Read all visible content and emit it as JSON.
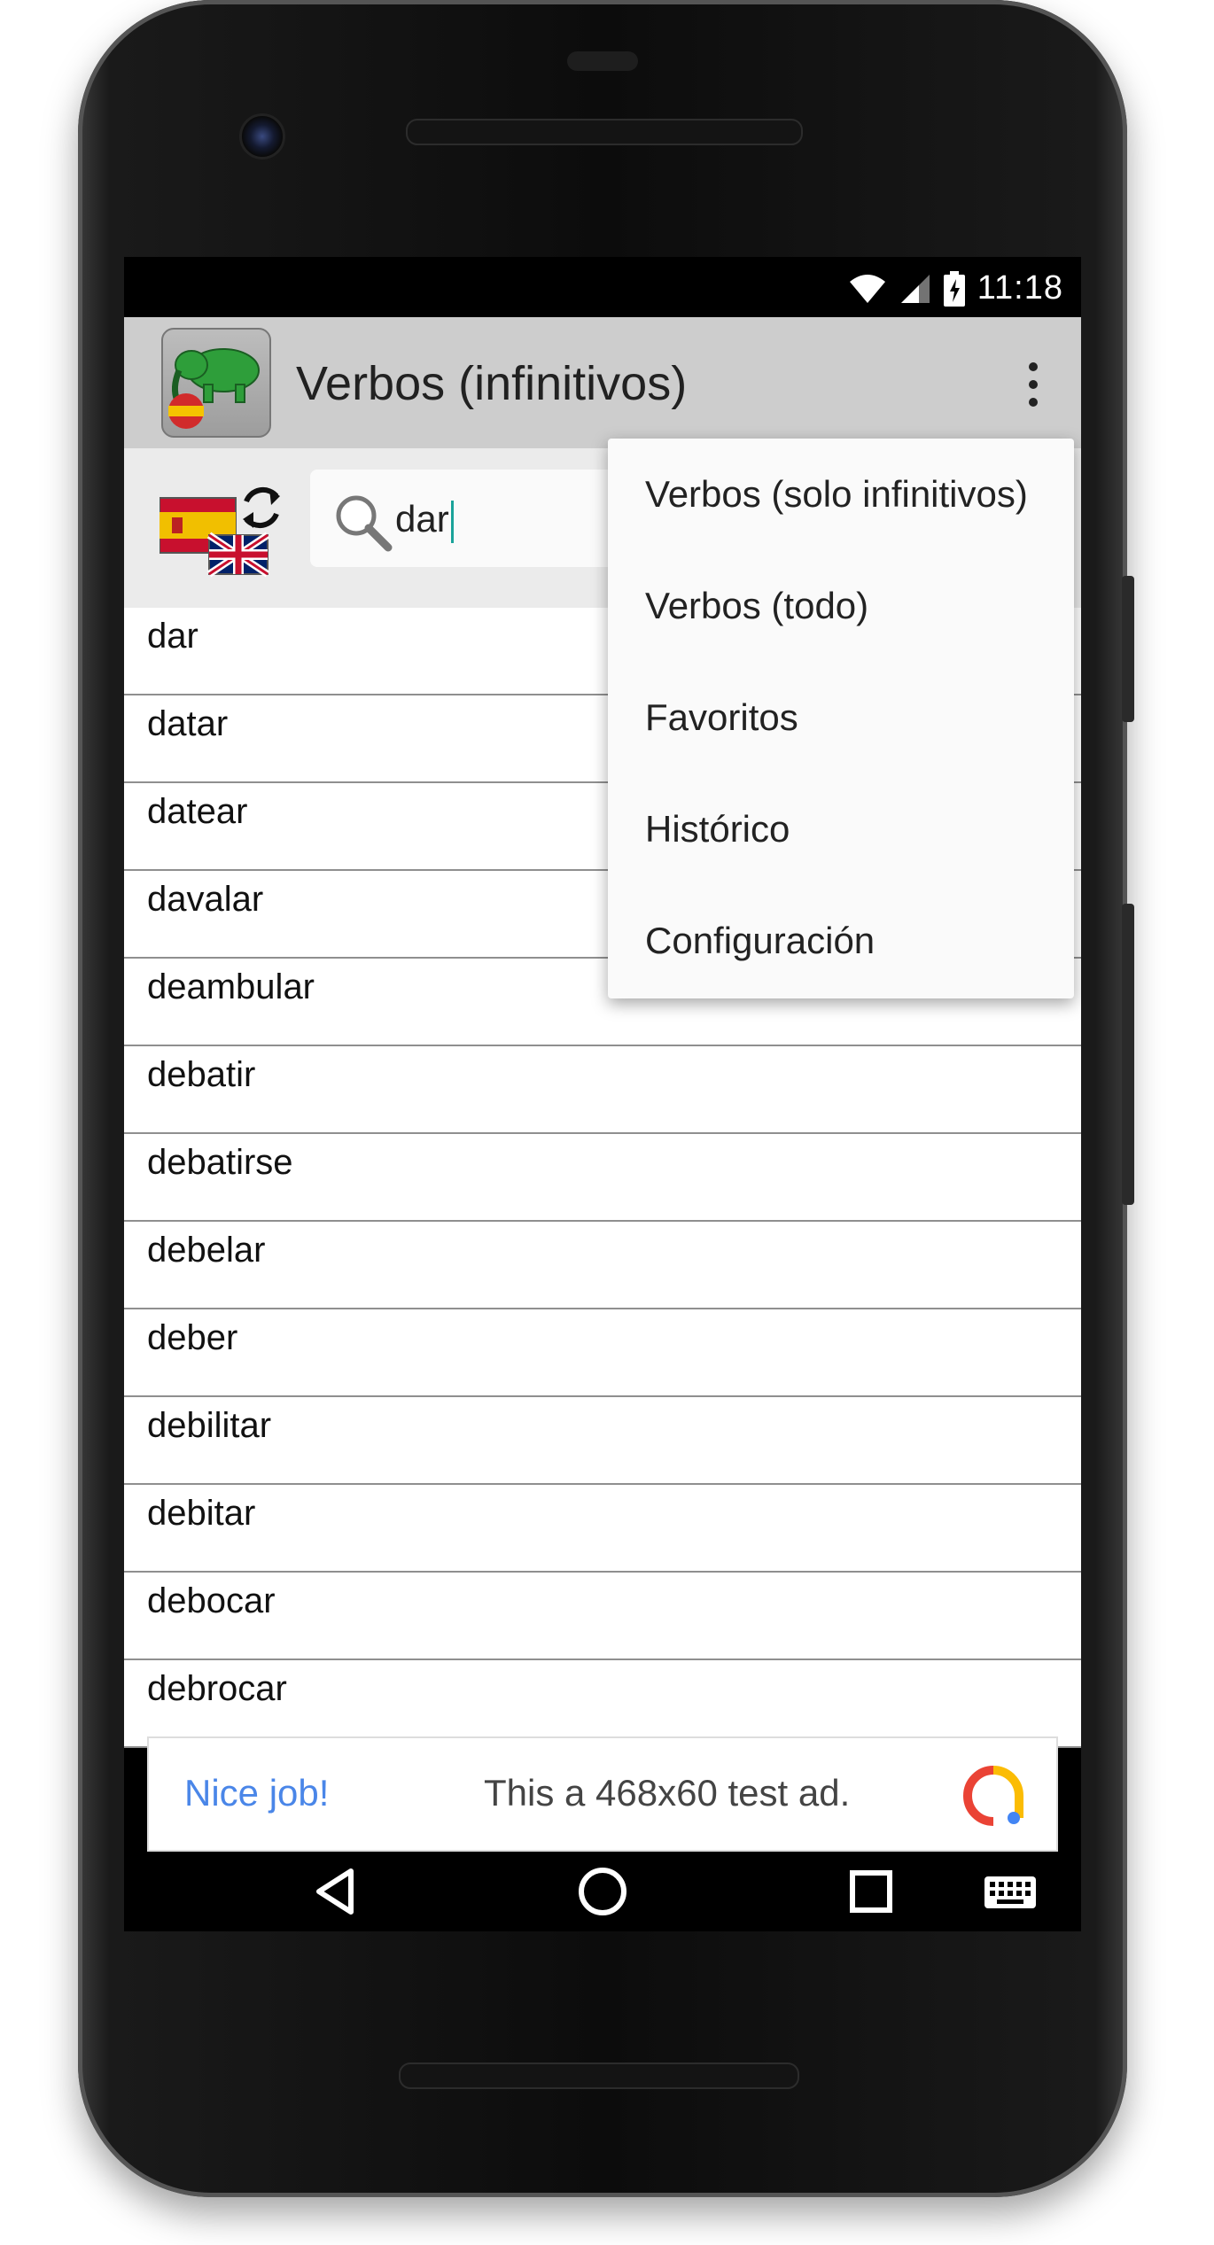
{
  "status": {
    "time": "11:18"
  },
  "appbar": {
    "title": "Verbos (infinitivos)"
  },
  "search": {
    "value": "dar"
  },
  "list": {
    "items": [
      "dar",
      "datar",
      "datear",
      "davalar",
      "deambular",
      "debatir",
      "debatirse",
      "debelar",
      "deber",
      "debilitar",
      "debitar",
      "debocar",
      "debrocar"
    ]
  },
  "menu": {
    "items": [
      "Verbos (solo infinitivos)",
      "Verbos (todo)",
      "Favoritos",
      "Histórico",
      "Configuración"
    ]
  },
  "ad": {
    "left_text": "Nice job!",
    "right_text": "This a 468x60 test ad."
  },
  "colors": {
    "appbar": "#cdcdcd",
    "accent": "#1aa39a",
    "ad_link": "#4a86e8"
  }
}
